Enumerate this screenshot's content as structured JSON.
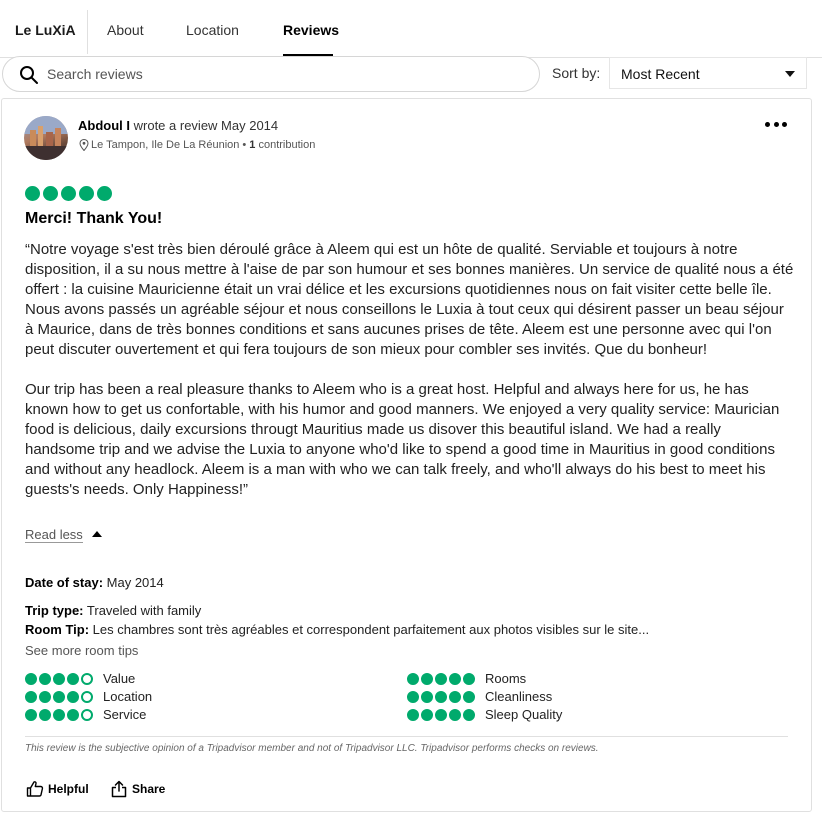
{
  "brand": "Le LuXiA",
  "tabs": [
    {
      "label": "About",
      "active": false
    },
    {
      "label": "Location",
      "active": false
    },
    {
      "label": "Reviews",
      "active": true
    }
  ],
  "search": {
    "placeholder": "Search reviews",
    "value": ""
  },
  "sort": {
    "label": "Sort by:",
    "selected": "Most Recent"
  },
  "review": {
    "author": "Abdoul I",
    "action_text": "wrote a review May 2014",
    "location": "Le Tampon, Ile De La Réunion",
    "contributions_count": "1",
    "contributions_label": "contribution",
    "rating": 5,
    "title": "Merci! Thank You!",
    "body_fr": "“Notre voyage s'est très bien déroulé grâce à Aleem qui est un hôte de qualité. Serviable et toujours à notre disposition, il a su nous mettre à l'aise de par son humour et ses bonnes manières. Un service de qualité nous a été offert : la cuisine Mauricienne était un vrai délice et les excursions quotidiennes nous on fait visiter cette belle île. Nous avons passés un agréable séjour et nous conseillons le Luxia à tout ceux qui désirent passer un beau séjour à Maurice, dans de très bonnes conditions et sans aucunes prises de tête. Aleem est une personne avec qui l'on peut discuter ouvertement et qui fera toujours de son mieux pour combler ses invités. Que du bonheur!",
    "body_en": "Our trip has been a real pleasure thanks to Aleem who is a great host. Helpful and always here for us, he has known how to get us confortable, with his humor and good manners. We enjoyed a very quality service: Maurician food is delicious, daily excursions througt Mauritius made us disover this beautiful island. We had a really handsome trip and we advise the Luxia to anyone who'd like to spend a good time in Mauritius in good conditions and without any headlock. Aleem is a man with who we can talk freely, and who'll always do his best to meet his guests's needs. Only Happiness!”",
    "read_less": "Read less",
    "date_of_stay_label": "Date of stay:",
    "date_of_stay": "May 2014",
    "trip_type_label": "Trip type:",
    "trip_type": "Traveled with family",
    "room_tip_label": "Room Tip:",
    "room_tip": "Les chambres sont très agréables et correspondent parfaitement aux photos visibles sur le site...",
    "see_more_tips": "See more room tips",
    "sub_ratings": [
      {
        "label": "Value",
        "rating": 4
      },
      {
        "label": "Location",
        "rating": 4
      },
      {
        "label": "Service",
        "rating": 4
      },
      {
        "label": "Rooms",
        "rating": 5
      },
      {
        "label": "Cleanliness",
        "rating": 5
      },
      {
        "label": "Sleep Quality",
        "rating": 5
      }
    ],
    "disclaimer": "This review is the subjective opinion of a Tripadvisor member and not of Tripadvisor LLC. Tripadvisor performs checks on reviews.",
    "helpful_label": "Helpful",
    "share_label": "Share"
  },
  "colors": {
    "bubble": "#00aa6c",
    "accent": "#000000"
  }
}
